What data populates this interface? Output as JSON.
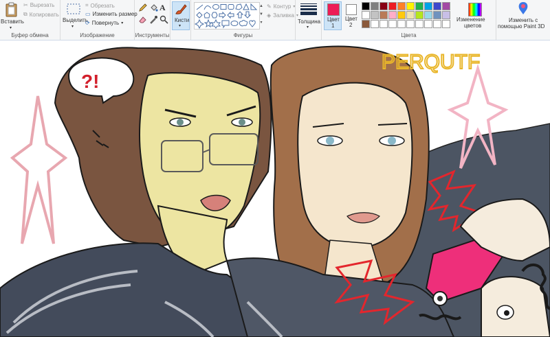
{
  "clipboard": {
    "paste_label": "Вставить",
    "cut_label": "Вырезать",
    "copy_label": "Копировать",
    "group_label": "Буфер обмена"
  },
  "image": {
    "select_label": "Выделить",
    "crop_label": "Обрезать",
    "resize_label": "Изменить размер",
    "rotate_label": "Повернуть",
    "group_label": "Изображение"
  },
  "tools": {
    "text_glyph": "A",
    "group_label": "Инструменты"
  },
  "brushes": {
    "label": "Кисти"
  },
  "shapes": {
    "outline_label": "Контур",
    "fill_label": "Заливка",
    "group_label": "Фигуры"
  },
  "size": {
    "label": "Толщина"
  },
  "colors": {
    "color1_label": "Цвет\n1",
    "color1_line1": "Цвет",
    "color1_line2": "1",
    "color2_line1": "Цвет",
    "color2_line2": "2",
    "edit_line1": "Изменение",
    "edit_line2": "цветов",
    "group_label": "Цвета",
    "color1": "#ed1c56",
    "color2": "#ffffff",
    "palette_row1": [
      "#000000",
      "#7f7f7f",
      "#880015",
      "#ed1c24",
      "#ff7f27",
      "#fff200",
      "#22b14c",
      "#00a2e8",
      "#3f48cc",
      "#a349a4"
    ],
    "palette_row2": [
      "#ffffff",
      "#c3c3c3",
      "#b97a57",
      "#ffaec9",
      "#ffc90e",
      "#efe4b0",
      "#b5e61d",
      "#99d9ea",
      "#7092be",
      "#c8bfe7"
    ],
    "palette_row3": [
      "#8b5a3c",
      "#ffffff",
      "#ffffff",
      "#ffffff",
      "#ffffff",
      "#ffffff",
      "#ffffff",
      "#ffffff",
      "#ffffff",
      "#ffffff"
    ]
  },
  "paint3d": {
    "line1": "Изменить с",
    "line2": "помощью Paint 3D"
  },
  "drawing": {
    "bubble_text": "?!",
    "scribble_text": "PERQUTF"
  }
}
